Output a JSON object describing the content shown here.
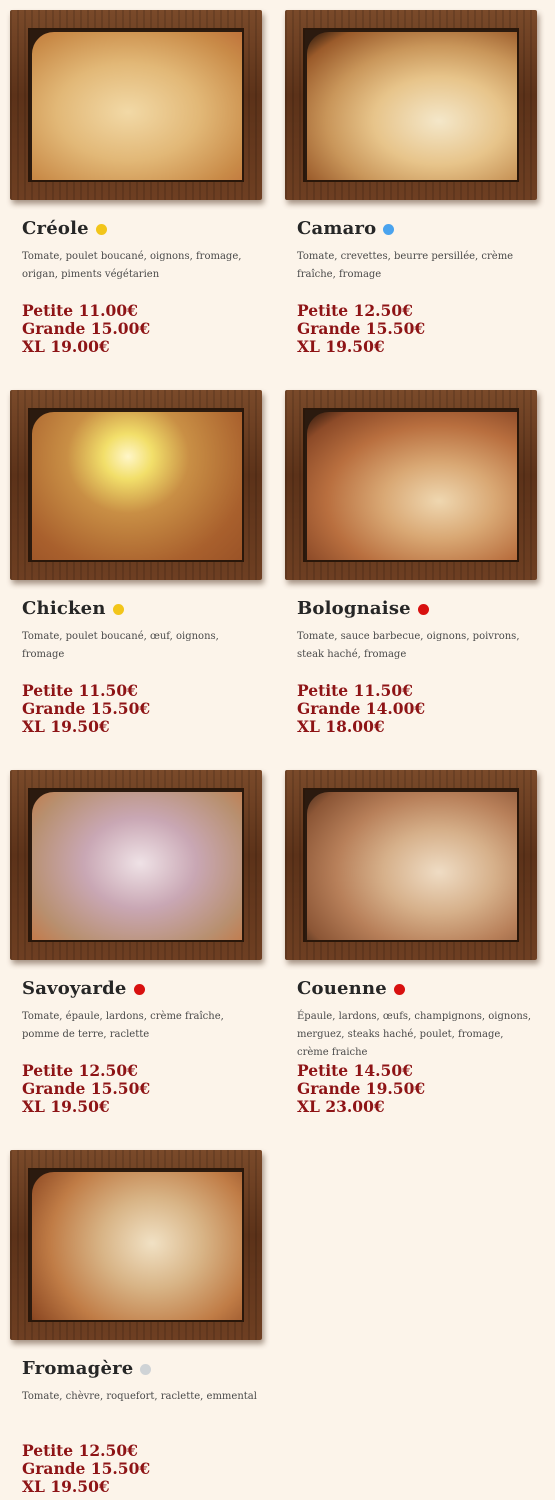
{
  "colors": {
    "background": "#fcf4ea",
    "price": "#8e1416",
    "name": "#262626",
    "dot_yellow": "#f2c51a",
    "dot_blue": "#4aa3ee",
    "dot_red": "#d8100f",
    "dot_grey": "#cfd3d6"
  },
  "pizzas": [
    {
      "name": "Créole",
      "dot": "yellow",
      "description": "Tomate, poulet boucané, oignons, fromage, origan, piments végétarien",
      "prices": [
        "Petite 11.00€",
        "Grande 15.00€",
        "XL 19.00€"
      ]
    },
    {
      "name": "Camaro",
      "dot": "blue",
      "description": "Tomate, crevettes, beurre persillée, crème fraîche, fromage",
      "prices": [
        "Petite 12.50€",
        "Grande 15.50€",
        "XL 19.50€"
      ]
    },
    {
      "name": "Chicken",
      "dot": "yellow",
      "description": "Tomate, poulet boucané, œuf, oignons, fromage",
      "prices": [
        "Petite 11.50€",
        "Grande 15.50€",
        "XL 19.50€"
      ]
    },
    {
      "name": "Bolognaise",
      "dot": "red",
      "description": "Tomate, sauce barbecue, oignons, poivrons, steak haché, fromage",
      "prices": [
        "Petite 11.50€",
        "Grande 14.00€",
        "XL 18.00€"
      ]
    },
    {
      "name": "Savoyarde",
      "dot": "red",
      "description": "Tomate, épaule, lardons, crème fraîche, pomme de terre, raclette",
      "prices": [
        "Petite 12.50€",
        "Grande 15.50€",
        "XL 19.50€"
      ]
    },
    {
      "name": "Couenne",
      "dot": "red",
      "description": "Épaule, lardons, œufs, champignons, oignons, merguez, steaks haché, poulet, fromage, crème fraiche",
      "prices": [
        "Petite 14.50€",
        "Grande 19.50€",
        "XL 23.00€"
      ]
    },
    {
      "name": "Fromagère",
      "dot": "grey",
      "description": "Tomate, chèvre, roquefort, raclette, emmental",
      "prices": [
        "Petite 12.50€",
        "Grande 15.50€",
        "XL 19.50€"
      ]
    }
  ]
}
